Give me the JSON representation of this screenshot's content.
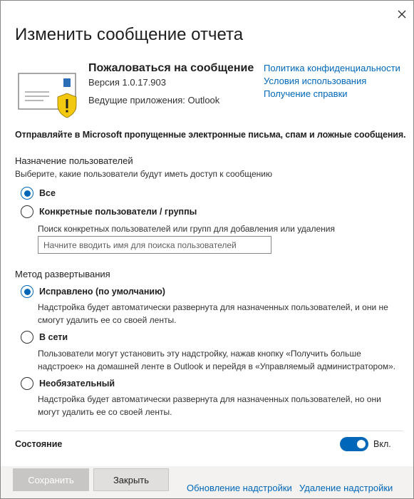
{
  "dialog": {
    "title": "Изменить сообщение отчета"
  },
  "app": {
    "name": "Пожаловаться на сообщение",
    "version": "Версия 1.0.17.903",
    "host": "Ведущие приложения: Outlook",
    "links": {
      "privacy": "Политика конфиденциальности",
      "terms": "Условия использования",
      "help": "Получение справки"
    }
  },
  "intro": "Отправляйте в Microsoft пропущенные электронные письма, спам и ложные сообщения.",
  "assignment": {
    "title": "Назначение пользователей",
    "description": "Выберите, какие пользователи будут иметь доступ к сообщению",
    "options": [
      {
        "label": "Все",
        "selected": true
      },
      {
        "label": "Конкретные пользователи / группы",
        "selected": false
      }
    ],
    "search_help": "Поиск конкретных пользователей или групп для добавления или удаления",
    "search_placeholder": "Начните вводить имя для поиска пользователей"
  },
  "deployment": {
    "title": "Метод развертывания",
    "options": [
      {
        "label": "Исправлено (по умолчанию)",
        "selected": true,
        "help": "Надстройка будет автоматически развернута для назначенных пользователей, и они не смогут удалить ее со своей ленты."
      },
      {
        "label": "В сети",
        "selected": false,
        "help": "Пользователи могут установить эту надстройку, нажав кнопку «Получить больше надстроек» на домашней ленте в Outlook и перейдя в «Управляемый администратором»."
      },
      {
        "label": "Необязательный",
        "selected": false,
        "help": "Надстройка будет автоматически развернута для назначенных пользователей, но они могут удалить ее со своей ленты."
      }
    ]
  },
  "status": {
    "label": "Состояние",
    "toggle_text": "Вкл.",
    "on": true
  },
  "footer": {
    "save_label": "Сохранить",
    "close_label": "Закрыть",
    "update_link": "Обновление надстройки",
    "remove_link": "Удаление надстройки"
  },
  "colors": {
    "accent": "#0067b8",
    "warning": "#f2c811",
    "envelope_stamp": "#2b6fb8"
  }
}
